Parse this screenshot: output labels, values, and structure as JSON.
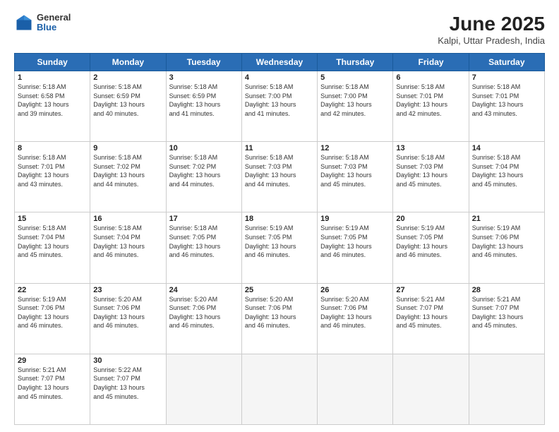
{
  "header": {
    "logo": {
      "general": "General",
      "blue": "Blue"
    },
    "title": "June 2025",
    "location": "Kalpi, Uttar Pradesh, India"
  },
  "weekdays": [
    "Sunday",
    "Monday",
    "Tuesday",
    "Wednesday",
    "Thursday",
    "Friday",
    "Saturday"
  ],
  "weeks": [
    [
      {
        "day": "1",
        "info": "Sunrise: 5:18 AM\nSunset: 6:58 PM\nDaylight: 13 hours\nand 39 minutes."
      },
      {
        "day": "2",
        "info": "Sunrise: 5:18 AM\nSunset: 6:59 PM\nDaylight: 13 hours\nand 40 minutes."
      },
      {
        "day": "3",
        "info": "Sunrise: 5:18 AM\nSunset: 6:59 PM\nDaylight: 13 hours\nand 41 minutes."
      },
      {
        "day": "4",
        "info": "Sunrise: 5:18 AM\nSunset: 7:00 PM\nDaylight: 13 hours\nand 41 minutes."
      },
      {
        "day": "5",
        "info": "Sunrise: 5:18 AM\nSunset: 7:00 PM\nDaylight: 13 hours\nand 42 minutes."
      },
      {
        "day": "6",
        "info": "Sunrise: 5:18 AM\nSunset: 7:01 PM\nDaylight: 13 hours\nand 42 minutes."
      },
      {
        "day": "7",
        "info": "Sunrise: 5:18 AM\nSunset: 7:01 PM\nDaylight: 13 hours\nand 43 minutes."
      }
    ],
    [
      {
        "day": "8",
        "info": "Sunrise: 5:18 AM\nSunset: 7:01 PM\nDaylight: 13 hours\nand 43 minutes."
      },
      {
        "day": "9",
        "info": "Sunrise: 5:18 AM\nSunset: 7:02 PM\nDaylight: 13 hours\nand 44 minutes."
      },
      {
        "day": "10",
        "info": "Sunrise: 5:18 AM\nSunset: 7:02 PM\nDaylight: 13 hours\nand 44 minutes."
      },
      {
        "day": "11",
        "info": "Sunrise: 5:18 AM\nSunset: 7:03 PM\nDaylight: 13 hours\nand 44 minutes."
      },
      {
        "day": "12",
        "info": "Sunrise: 5:18 AM\nSunset: 7:03 PM\nDaylight: 13 hours\nand 45 minutes."
      },
      {
        "day": "13",
        "info": "Sunrise: 5:18 AM\nSunset: 7:03 PM\nDaylight: 13 hours\nand 45 minutes."
      },
      {
        "day": "14",
        "info": "Sunrise: 5:18 AM\nSunset: 7:04 PM\nDaylight: 13 hours\nand 45 minutes."
      }
    ],
    [
      {
        "day": "15",
        "info": "Sunrise: 5:18 AM\nSunset: 7:04 PM\nDaylight: 13 hours\nand 45 minutes."
      },
      {
        "day": "16",
        "info": "Sunrise: 5:18 AM\nSunset: 7:04 PM\nDaylight: 13 hours\nand 46 minutes."
      },
      {
        "day": "17",
        "info": "Sunrise: 5:18 AM\nSunset: 7:05 PM\nDaylight: 13 hours\nand 46 minutes."
      },
      {
        "day": "18",
        "info": "Sunrise: 5:19 AM\nSunset: 7:05 PM\nDaylight: 13 hours\nand 46 minutes."
      },
      {
        "day": "19",
        "info": "Sunrise: 5:19 AM\nSunset: 7:05 PM\nDaylight: 13 hours\nand 46 minutes."
      },
      {
        "day": "20",
        "info": "Sunrise: 5:19 AM\nSunset: 7:05 PM\nDaylight: 13 hours\nand 46 minutes."
      },
      {
        "day": "21",
        "info": "Sunrise: 5:19 AM\nSunset: 7:06 PM\nDaylight: 13 hours\nand 46 minutes."
      }
    ],
    [
      {
        "day": "22",
        "info": "Sunrise: 5:19 AM\nSunset: 7:06 PM\nDaylight: 13 hours\nand 46 minutes."
      },
      {
        "day": "23",
        "info": "Sunrise: 5:20 AM\nSunset: 7:06 PM\nDaylight: 13 hours\nand 46 minutes."
      },
      {
        "day": "24",
        "info": "Sunrise: 5:20 AM\nSunset: 7:06 PM\nDaylight: 13 hours\nand 46 minutes."
      },
      {
        "day": "25",
        "info": "Sunrise: 5:20 AM\nSunset: 7:06 PM\nDaylight: 13 hours\nand 46 minutes."
      },
      {
        "day": "26",
        "info": "Sunrise: 5:20 AM\nSunset: 7:06 PM\nDaylight: 13 hours\nand 46 minutes."
      },
      {
        "day": "27",
        "info": "Sunrise: 5:21 AM\nSunset: 7:07 PM\nDaylight: 13 hours\nand 45 minutes."
      },
      {
        "day": "28",
        "info": "Sunrise: 5:21 AM\nSunset: 7:07 PM\nDaylight: 13 hours\nand 45 minutes."
      }
    ],
    [
      {
        "day": "29",
        "info": "Sunrise: 5:21 AM\nSunset: 7:07 PM\nDaylight: 13 hours\nand 45 minutes."
      },
      {
        "day": "30",
        "info": "Sunrise: 5:22 AM\nSunset: 7:07 PM\nDaylight: 13 hours\nand 45 minutes."
      },
      {
        "day": "",
        "info": ""
      },
      {
        "day": "",
        "info": ""
      },
      {
        "day": "",
        "info": ""
      },
      {
        "day": "",
        "info": ""
      },
      {
        "day": "",
        "info": ""
      }
    ]
  ]
}
